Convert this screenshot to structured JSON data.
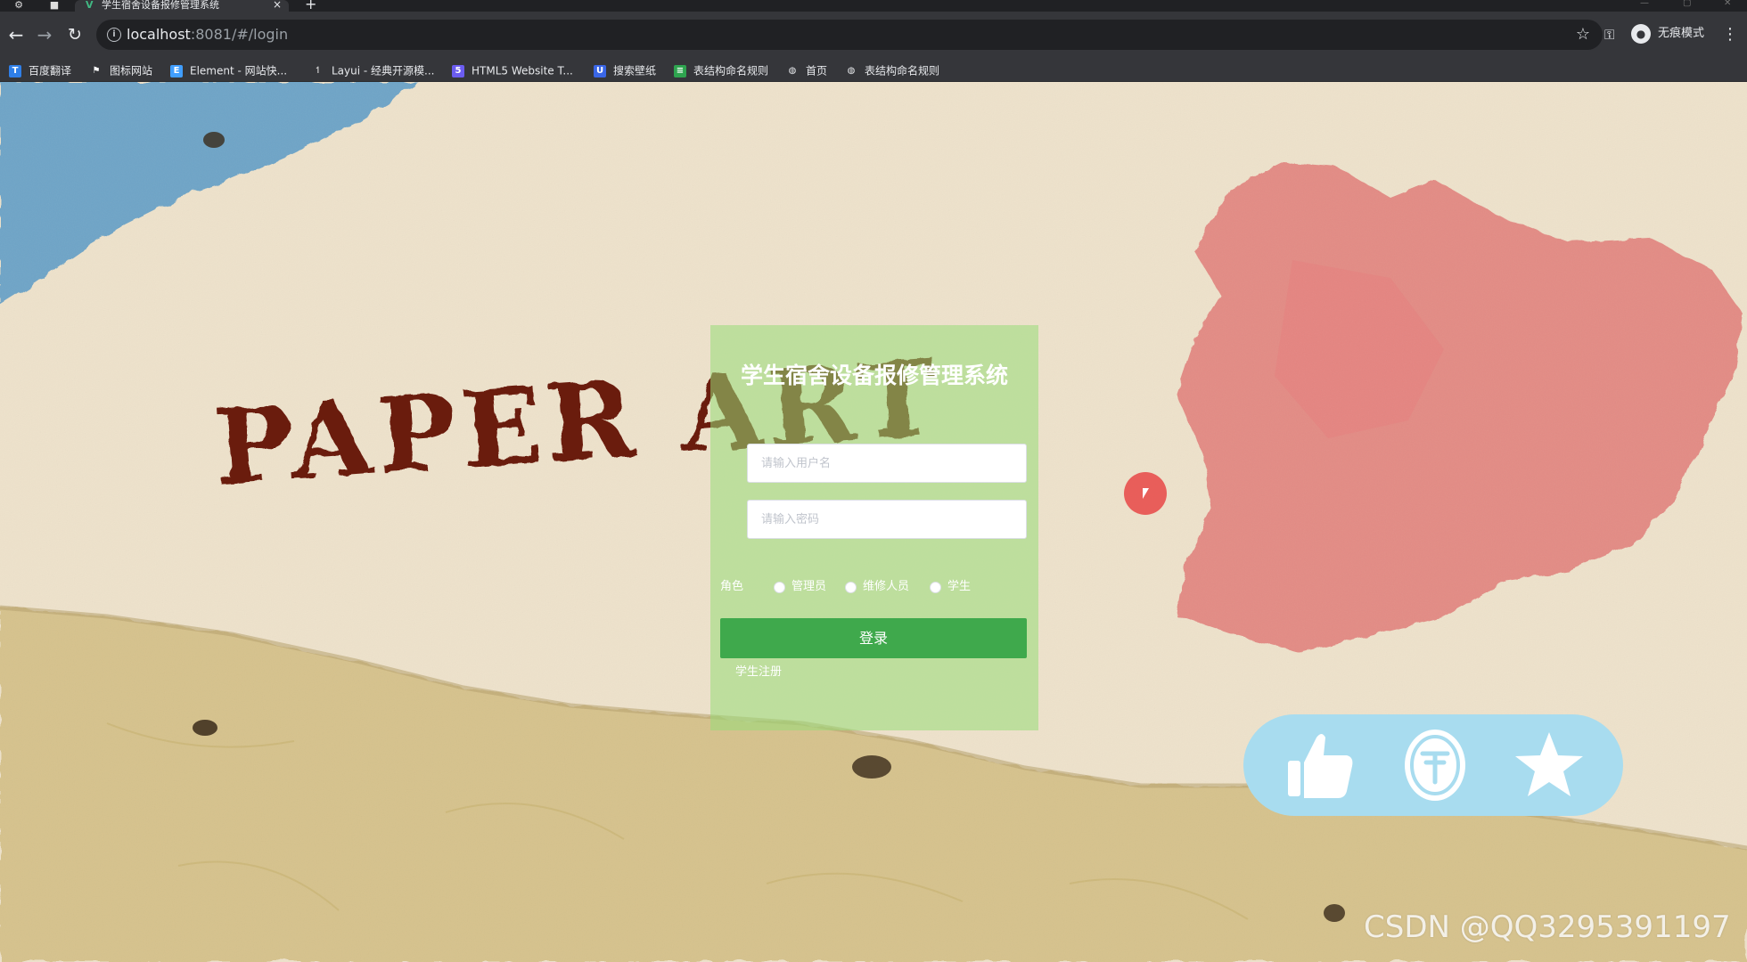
{
  "browser": {
    "tab": {
      "title": "学生宿舍设备报修管理系统",
      "close": "×"
    },
    "new_tab": "+",
    "address": {
      "host": "localhost",
      "rest": ":8081/#/login"
    },
    "profile_label": "无痕模式",
    "bookmarks": [
      {
        "label": "百度翻译",
        "icon": "baidu-translate-icon",
        "color": "#2f7fe8"
      },
      {
        "label": "图标网站",
        "icon": "flag-icon",
        "color": "#ffffff"
      },
      {
        "label": "Element - 网站快...",
        "icon": "element-icon",
        "color": "#409eff"
      },
      {
        "label": "Layui - 经典开源模...",
        "icon": "layui-icon",
        "color": "#cccccc"
      },
      {
        "label": "HTML5 Website T...",
        "icon": "html5-icon",
        "color": "#6b5cf0"
      },
      {
        "label": "搜索壁纸",
        "icon": "wallpaper-icon",
        "color": "#3a66e6"
      },
      {
        "label": "表结构命名规则",
        "icon": "table-icon",
        "color": "#2ea44f"
      },
      {
        "label": "首页",
        "icon": "globe-icon",
        "color": "#e8eaed"
      },
      {
        "label": "表结构命名规则",
        "icon": "globe-icon",
        "color": "#e8eaed"
      }
    ]
  },
  "background": {
    "logo_text": "PAPER ART",
    "colors": {
      "paper": "#eee2cb",
      "blue_paper": "#6ea4c7",
      "red_stain": "#e06a6a",
      "yellow_paper": "#d6c28c",
      "logo": "#6b1a0f"
    }
  },
  "login": {
    "title": "学生宿舍设备报修管理系统",
    "username_placeholder": "请输入用户名",
    "password_placeholder": "请输入密码",
    "role_label": "角色",
    "roles": [
      "管理员",
      "维修人员",
      "学生"
    ],
    "submit_label": "登录",
    "register_label": "学生注册",
    "accent": "#3fa94c"
  },
  "actions": {
    "like": "thumbs-up-icon",
    "coin": "coin-icon",
    "favorite": "star-icon",
    "background": "#a8dcef"
  },
  "watermark": "CSDN @QQ3295391197"
}
